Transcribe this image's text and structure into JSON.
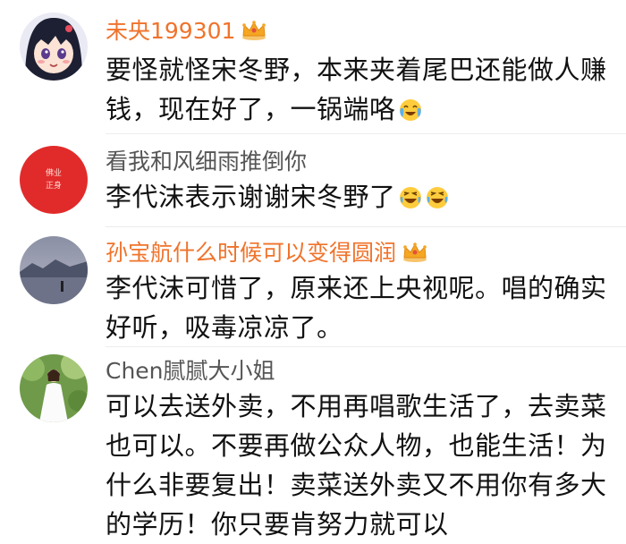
{
  "colors": {
    "vip_name": "#f0732b",
    "normal_name": "#555555",
    "text": "#111111"
  },
  "comments": [
    {
      "username": "未央199301",
      "vip": true,
      "lines": [
        "要怪就怪宋冬野，本来夹着尾巴还能做人赚",
        "钱，现在好了，一锅端咯"
      ],
      "emoji": "crying-laughing-emoji",
      "avatar": "anime-girl-avatar"
    },
    {
      "username": "看我和风细雨推倒你",
      "vip": false,
      "lines": [
        "李代沫表示谢谢宋冬野了"
      ],
      "emoji": "laughing-emoji x2",
      "avatar": "red-circle-avatar",
      "avatar_text": [
        "佛业",
        "正身"
      ]
    },
    {
      "username": "孙宝航什么时候可以变得圆润",
      "vip": true,
      "lines": [
        "李代沫可惜了，原来还上央视呢。唱的确实",
        "好听，吸毒凉凉了。"
      ],
      "avatar": "lake-landscape-avatar"
    },
    {
      "username": "Chen腻腻大小姐",
      "vip": false,
      "lines": [
        "可以去送外卖，不用再唱歌生活了，去卖菜",
        "也可以。不要再做公众人物，也能生活！为",
        "什么非要复出！卖菜送外卖又不用你有多大",
        "的学历！你只要肯努力就可以"
      ],
      "avatar": "girl-in-white-dress-avatar"
    }
  ]
}
